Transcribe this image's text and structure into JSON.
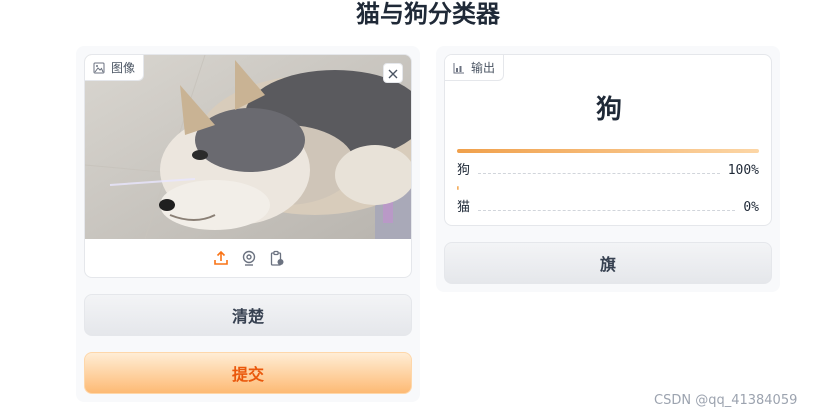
{
  "app": {
    "title": "猫与狗分类器"
  },
  "input": {
    "label": "图像",
    "clear_label": "清楚",
    "submit_label": "提交",
    "source_icons": [
      "upload-icon",
      "webcam-icon",
      "clipboard-icon"
    ]
  },
  "output": {
    "label": "输出",
    "predicted": "狗",
    "confidences": [
      {
        "name": "狗",
        "value_text": "100%",
        "value": 1.0
      },
      {
        "name": "猫",
        "value_text": "0%",
        "value": 0.0
      }
    ],
    "flag_label": "旗"
  },
  "watermark": "CSDN @qq_41384059",
  "colors": {
    "accent": "#f97316",
    "bar_start": "#f0a04b",
    "bar_end": "#fcd6a6"
  }
}
